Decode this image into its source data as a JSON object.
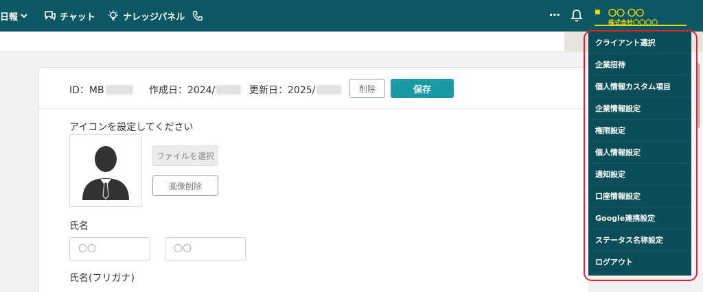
{
  "nav": {
    "daily_report": "日報",
    "chat": "チャット",
    "knowledge_panel": "ナレッジパネル"
  },
  "user": {
    "name": "〇〇 〇〇",
    "company": "株式会社〇〇〇〇"
  },
  "header": {
    "id_label": "ID：MB",
    "created_label": "作成日：2024/",
    "updated_label": "更新日：2025/",
    "delete_button": "削除",
    "save_button": "保存"
  },
  "form": {
    "icon_label": "アイコンを設定してください",
    "file_select_button": "ファイルを選択",
    "image_delete_button": "画像削除",
    "name_label": "氏名",
    "last_name_placeholder": "〇〇",
    "first_name_placeholder": "〇〇",
    "kana_label": "氏名(フリガナ)"
  },
  "menu": {
    "items": [
      "クライアント選択",
      "企業招待",
      "個人情報カスタム項目",
      "企業情報設定",
      "権限設定",
      "個人情報設定",
      "通知設定",
      "口座情報設定",
      "Google連携設定",
      "ステータス名称設定",
      "ログアウト"
    ]
  },
  "colors": {
    "topbar": "#0b5763",
    "menu": "#0b4e58",
    "accent": "#1a9aa5",
    "user_text": "#f0dc00",
    "highlight": "#e01e2e"
  }
}
